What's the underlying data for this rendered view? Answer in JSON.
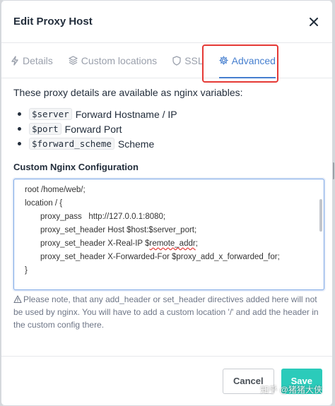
{
  "modal": {
    "title": "Edit Proxy Host"
  },
  "tabs": [
    {
      "label": "Details",
      "icon": "bolt-icon",
      "active": false
    },
    {
      "label": "Custom locations",
      "icon": "layers-icon",
      "active": false
    },
    {
      "label": "SSL",
      "icon": "shield-icon",
      "active": false
    },
    {
      "label": "Advanced",
      "icon": "gear-icon",
      "active": true
    }
  ],
  "advanced": {
    "intro": "These proxy details are available as nginx variables:",
    "variables": [
      {
        "code": "$server",
        "desc": "Forward Hostname / IP"
      },
      {
        "code": "$port",
        "desc": "Forward Port"
      },
      {
        "code": "$forward_scheme",
        "desc": "Scheme"
      }
    ],
    "config_label": "Custom Nginx Configuration",
    "config_lines": [
      "root /home/web/;",
      "location / {",
      "proxy_pass   http://127.0.0.1:8080;",
      "proxy_set_header Host $host:$server_port;",
      "proxy_set_header X-Real-IP $",
      "remote_addr",
      ";",
      "proxy_set_header X-Forwarded-For $proxy_add_x_forwarded_for;",
      "}"
    ],
    "note": "Please note, that any add_header or set_header directives added here will not be used by nginx. You will have to add a custom location '/' and add the header in the custom config there."
  },
  "footer": {
    "cancel_label": "Cancel",
    "save_label": "Save"
  },
  "watermark": "知乎 @猪猪大侠",
  "colors": {
    "accent": "#467fcf",
    "save": "#2bcbba",
    "highlight": "#e53935"
  }
}
